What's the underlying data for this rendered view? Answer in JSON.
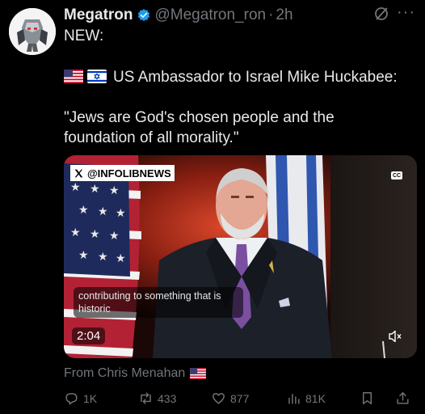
{
  "post": {
    "author_name": "Megatron",
    "handle": "@Megatron_ron",
    "separator": "·",
    "time": "2h",
    "more_label": "···",
    "lines": [
      "NEW:",
      "US Ambassador to Israel Mike Huckabee:",
      "\"Jews are God's chosen people and the",
      "foundation of all morality.\""
    ],
    "line2_flags": [
      "us-flag-icon",
      "israel-flag-icon"
    ]
  },
  "video": {
    "watermark": "@INFOLIBNEWS",
    "cc_label": "CC",
    "caption": "contributing to something that is historic",
    "duration": "2:04"
  },
  "source": {
    "label": "From Chris Menahan",
    "flag": "us-flag-icon"
  },
  "actions": {
    "replies": "1K",
    "reposts": "433",
    "likes": "877",
    "views": "81K"
  },
  "colors": {
    "background": "#000000",
    "primary_text": "#e7e9ea",
    "secondary_text": "#71767b",
    "verified": "#1d9bf0"
  }
}
